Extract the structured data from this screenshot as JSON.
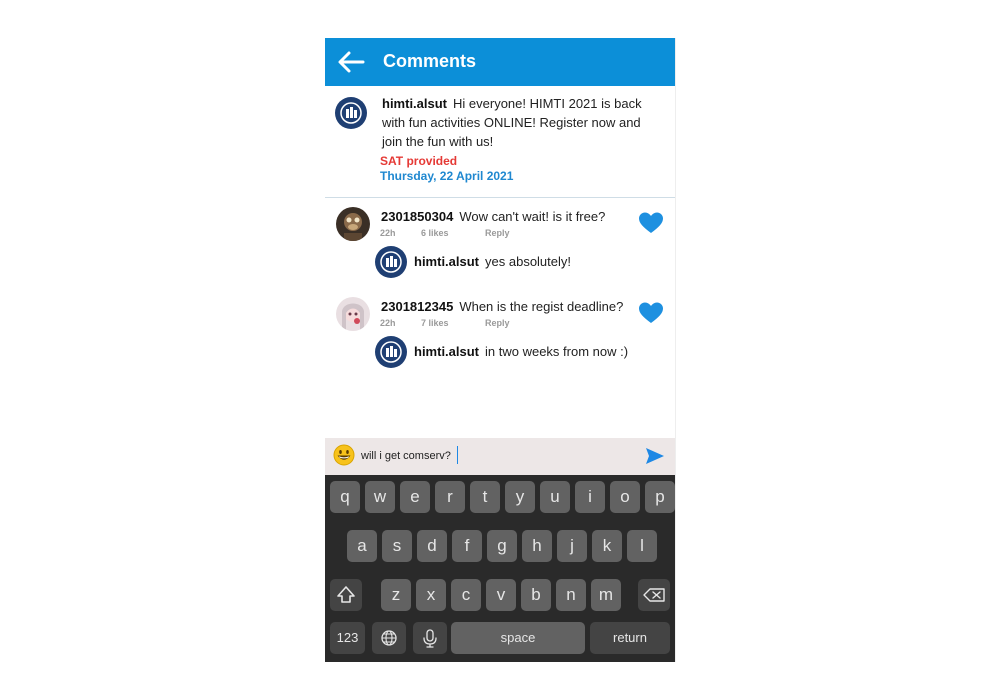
{
  "header": {
    "title": "Comments"
  },
  "post": {
    "username": "himti.alsut",
    "text": "Hi everyone! HIMTI 2021 is back with fun activities ONLINE! Register now and join the fun with us!",
    "tag": "SAT provided",
    "date": "Thursday, 22 April 2021"
  },
  "comments": [
    {
      "username": "2301850304",
      "text": "Wow can't wait! is it free?",
      "time": "22h",
      "likes": "6 likes",
      "reply_label": "Reply",
      "liked": true,
      "reply": {
        "username": "himti.alsut",
        "text": "yes absolutely!"
      }
    },
    {
      "username": "2301812345",
      "text": "When is the regist deadline?",
      "time": "22h",
      "likes": "7 likes",
      "reply_label": "Reply",
      "liked": true,
      "reply": {
        "username": "himti.alsut",
        "text": "in two weeks from now :)"
      }
    }
  ],
  "composer": {
    "value": "will i get comserv?",
    "emoji_icon": "grinning-face-icon",
    "send_icon": "send-icon"
  },
  "keyboard": {
    "row1": [
      "q",
      "w",
      "e",
      "r",
      "t",
      "y",
      "u",
      "i",
      "o",
      "p"
    ],
    "row2": [
      "a",
      "s",
      "d",
      "f",
      "g",
      "h",
      "j",
      "k",
      "l"
    ],
    "row3": [
      "z",
      "x",
      "c",
      "v",
      "b",
      "n",
      "m"
    ],
    "numbers": "123",
    "space": "space",
    "return": "return"
  },
  "colors": {
    "accent": "#0c8fd8",
    "tag": "#e53935",
    "date": "#1f88d0",
    "heart": "#1e90e0"
  }
}
